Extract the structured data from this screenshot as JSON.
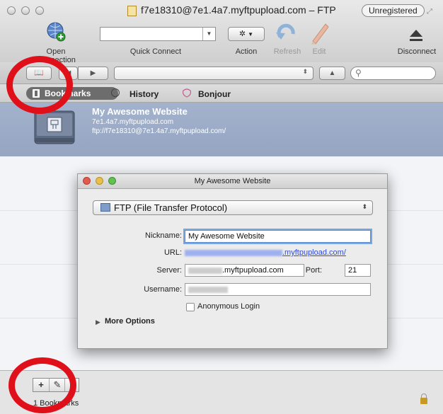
{
  "window": {
    "title": "f7e18310@7e1.4a7.myftpupload.com – FTP",
    "badge": "Unregistered"
  },
  "toolbar": {
    "open_connection": "Open Connection",
    "quick_connect": "Quick Connect",
    "quick_connect_value": "",
    "action": "Action",
    "refresh": "Refresh",
    "edit": "Edit",
    "disconnect": "Disconnect"
  },
  "tabs": {
    "bookmarks": "Bookmarks",
    "history": "History",
    "bonjour": "Bonjour"
  },
  "bookmark": {
    "name": "My Awesome Website",
    "host": "7e1.4a7.myftpupload.com",
    "url": "ftp://f7e18310@7e1.4a7.myftpupload.com/"
  },
  "status": {
    "count": "1 Bookmarks"
  },
  "dialog": {
    "title": "My Awesome Website",
    "protocol": "FTP (File Transfer Protocol)",
    "nickname_label": "Nickname:",
    "nickname_value": "My Awesome Website",
    "url_label": "URL:",
    "url_value_suffix": ".myftpupload.com/",
    "server_label": "Server:",
    "server_value_suffix": ".myftpupload.com",
    "port_label": "Port:",
    "port_value": "21",
    "username_label": "Username:",
    "anonymous_login": "Anonymous Login",
    "more_options": "More Options"
  },
  "colors": {
    "selection": "#a3b2cc",
    "annotation_ring": "#e0101b",
    "link": "#2f4bd6"
  }
}
